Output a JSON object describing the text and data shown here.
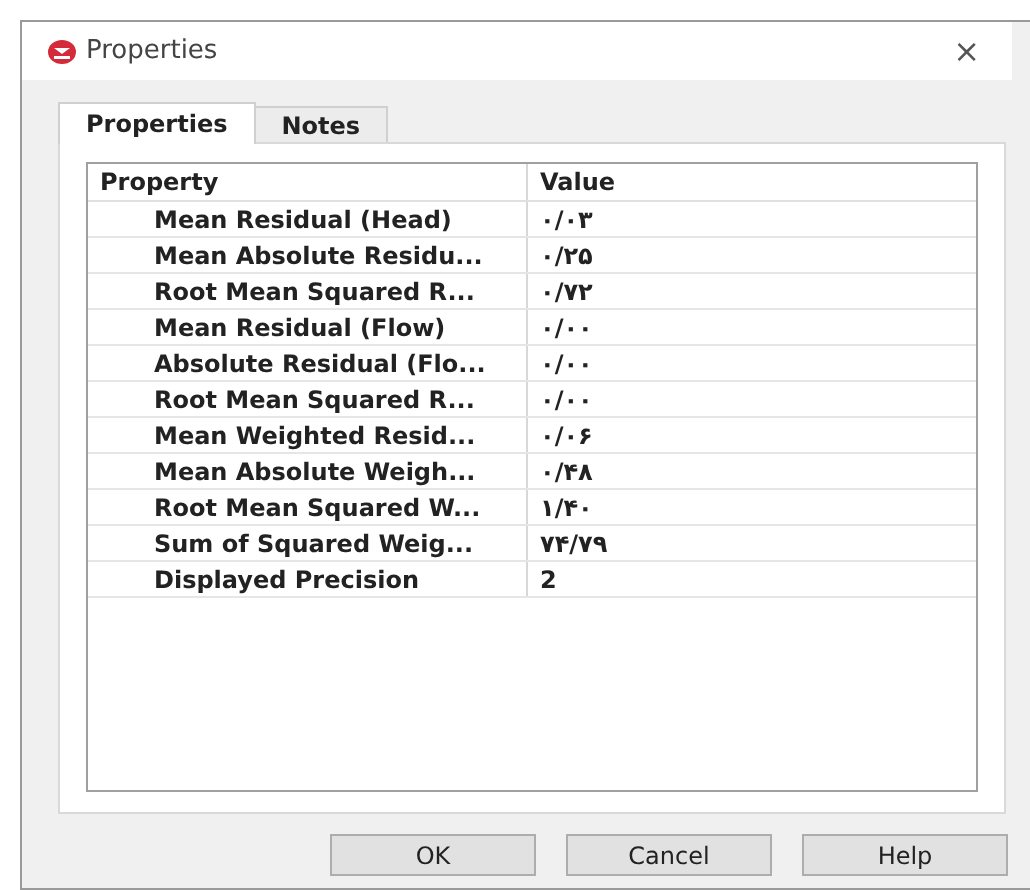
{
  "window": {
    "title": "Properties",
    "close": "×"
  },
  "tabs": {
    "properties_tab": {
      "label": "Properties",
      "selected": true
    },
    "notes_tab": {
      "label": "Notes",
      "selected": false
    }
  },
  "table": {
    "columns": {
      "property": "Property",
      "value": "Value"
    },
    "rows": [
      {
        "property": "Mean Residual (Head)",
        "value": "۰/۰۳"
      },
      {
        "property": "Mean Absolute Residu...",
        "value": "۰/۲۵"
      },
      {
        "property": "Root Mean Squared R...",
        "value": "۰/۷۲"
      },
      {
        "property": "Mean Residual (Flow)",
        "value": "۰/۰۰"
      },
      {
        "property": "Absolute Residual (Flo...",
        "value": "۰/۰۰"
      },
      {
        "property": "Root Mean Squared R...",
        "value": "۰/۰۰"
      },
      {
        "property": "Mean Weighted Resid...",
        "value": "۰/۰۶"
      },
      {
        "property": "Mean Absolute Weigh...",
        "value": "۰/۴۸"
      },
      {
        "property": "Root Mean Squared W...",
        "value": "۱/۴۰"
      },
      {
        "property": "Sum of Squared Weig...",
        "value": "۷۴/۷۹"
      },
      {
        "property": "Displayed Precision",
        "value": "2"
      }
    ]
  },
  "buttons": {
    "ok": "OK",
    "cancel": "Cancel",
    "help": "Help"
  }
}
